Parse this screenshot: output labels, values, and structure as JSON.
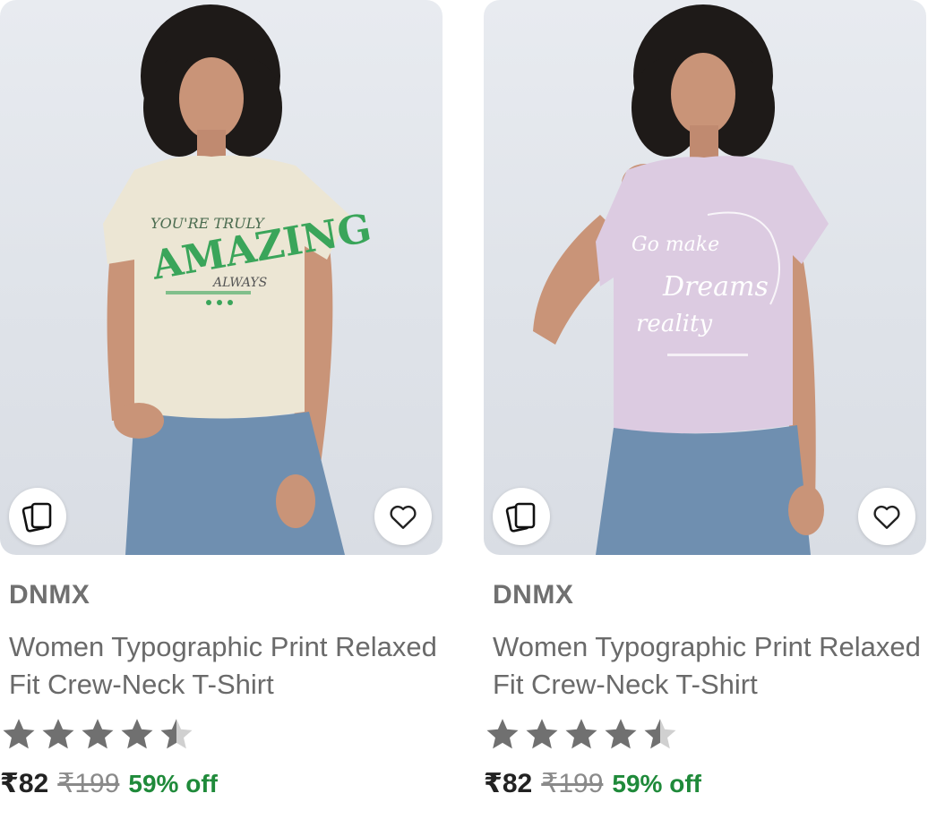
{
  "products": [
    {
      "brand": "DNMX",
      "title": "Women Typographic Print Relaxed Fit Crew-Neck T-Shirt",
      "rating": 4.5,
      "price": "₹82",
      "mrp": "₹199",
      "discount": "59% off",
      "tee_color": "#ece6d4",
      "print_color": "#3aa55a",
      "similar_icon": "cards-icon",
      "wishlist_icon": "heart-icon"
    },
    {
      "brand": "DNMX",
      "title": "Women Typographic Print Relaxed Fit Crew-Neck T-Shirt",
      "rating": 4.5,
      "price": "₹82",
      "mrp": "₹199",
      "discount": "59% off",
      "tee_color": "#dccbe1",
      "print_color": "#ffffff",
      "similar_icon": "cards-icon",
      "wishlist_icon": "heart-icon"
    }
  ],
  "colors": {
    "star_filled": "#707070",
    "star_empty": "#d0d0d0",
    "discount": "#1f8a3a",
    "jeans": "#6f8fb0",
    "hair": "#1e1a18",
    "skin": "#c99478"
  }
}
